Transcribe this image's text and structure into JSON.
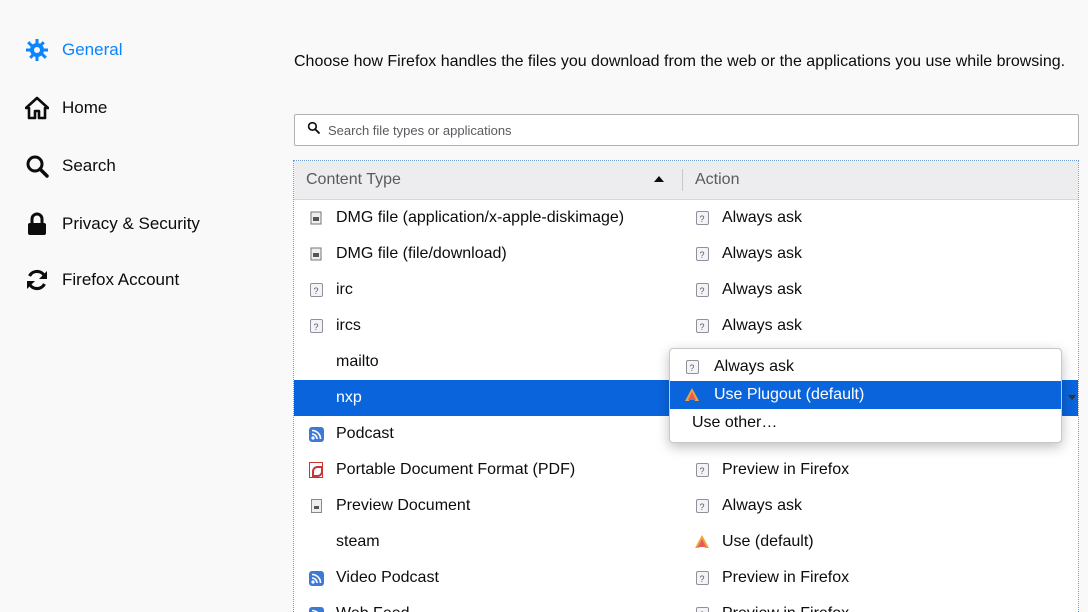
{
  "sidebar": {
    "items": [
      {
        "label": "General",
        "icon": "gear-icon",
        "active": true
      },
      {
        "label": "Home",
        "icon": "home-icon"
      },
      {
        "label": "Search",
        "icon": "search-icon"
      },
      {
        "label": "Privacy & Security",
        "icon": "lock-icon"
      },
      {
        "label": "Firefox Account",
        "icon": "sync-icon"
      }
    ]
  },
  "applications": {
    "description": "Choose how Firefox handles the files you download from the web or the applications you use while browsing.",
    "search_placeholder": "Search file types or applications",
    "columns": {
      "content_type": "Content Type",
      "action": "Action"
    },
    "rows": [
      {
        "type": "DMG file (application/x-apple-diskimage)",
        "type_icon": "disk-image-icon",
        "action": "Always ask",
        "action_icon": "ask-icon"
      },
      {
        "type": "DMG file (file/download)",
        "type_icon": "disk-image-icon",
        "action": "Always ask",
        "action_icon": "ask-icon"
      },
      {
        "type": "irc",
        "type_icon": "ask-icon",
        "action": "Always ask",
        "action_icon": "ask-icon"
      },
      {
        "type": "ircs",
        "type_icon": "ask-icon",
        "action": "Always ask",
        "action_icon": "ask-icon"
      },
      {
        "type": "mailto",
        "type_icon": "",
        "action": "",
        "action_icon": ""
      },
      {
        "type": "nxp",
        "type_icon": "",
        "action": "",
        "action_icon": "",
        "selected": true
      },
      {
        "type": "Podcast",
        "type_icon": "rss-icon",
        "action": "",
        "action_icon": ""
      },
      {
        "type": "Portable Document Format (PDF)",
        "type_icon": "pdf-icon",
        "action": "Preview in Firefox",
        "action_icon": "ask-icon"
      },
      {
        "type": "Preview Document",
        "type_icon": "document-icon",
        "action": "Always ask",
        "action_icon": "ask-icon"
      },
      {
        "type": "steam",
        "type_icon": "",
        "action": "Use  (default)",
        "action_icon": "app-icon"
      },
      {
        "type": "Video Podcast",
        "type_icon": "rss-icon",
        "action": "Preview in Firefox",
        "action_icon": "ask-icon"
      },
      {
        "type": "Web Feed",
        "type_icon": "rss-icon",
        "action": "Preview in Firefox",
        "action_icon": "ask-icon"
      }
    ],
    "dropdown": {
      "options": [
        {
          "label": "Always ask",
          "icon": "ask-icon"
        },
        {
          "label": "Use Plugout (default)",
          "icon": "plugout-app-icon",
          "highlighted": true
        },
        {
          "label": "Use other…",
          "icon": ""
        }
      ]
    }
  },
  "colors": {
    "accent": "#0a84ff",
    "selection": "#0a64dc"
  }
}
